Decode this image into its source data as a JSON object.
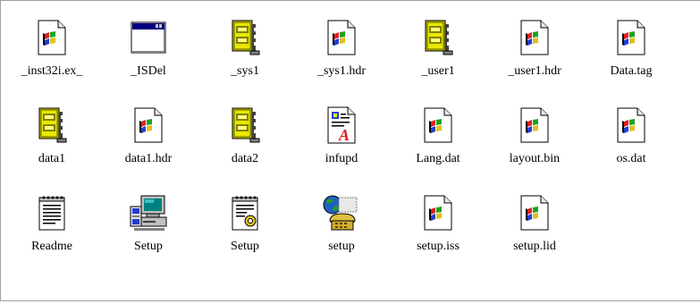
{
  "files": [
    {
      "label": "_inst32i.ex_",
      "icon": "generic-file-icon"
    },
    {
      "label": "_ISDel",
      "icon": "application-window-icon"
    },
    {
      "label": "_sys1",
      "icon": "compressed-archive-icon"
    },
    {
      "label": "_sys1.hdr",
      "icon": "generic-file-icon"
    },
    {
      "label": "_user1",
      "icon": "compressed-archive-icon"
    },
    {
      "label": "_user1.hdr",
      "icon": "generic-file-icon"
    },
    {
      "label": "Data.tag",
      "icon": "generic-file-icon"
    },
    {
      "label": "data1",
      "icon": "compressed-archive-icon"
    },
    {
      "label": "data1.hdr",
      "icon": "generic-file-icon"
    },
    {
      "label": "data2",
      "icon": "compressed-archive-icon"
    },
    {
      "label": "infupd",
      "icon": "wordpad-document-icon"
    },
    {
      "label": "Lang.dat",
      "icon": "generic-file-icon"
    },
    {
      "label": "layout.bin",
      "icon": "generic-file-icon"
    },
    {
      "label": "os.dat",
      "icon": "generic-file-icon"
    },
    {
      "label": "Readme",
      "icon": "notepad-text-icon"
    },
    {
      "label": "Setup",
      "icon": "setup-computer-icon"
    },
    {
      "label": "Setup",
      "icon": "setup-config-icon"
    },
    {
      "label": "setup",
      "icon": "internet-dialer-icon"
    },
    {
      "label": "setup.iss",
      "icon": "generic-file-icon"
    },
    {
      "label": "setup.lid",
      "icon": "generic-file-icon"
    }
  ],
  "colors": {
    "background": "#ffffff",
    "text": "#000000",
    "frame": "#a0a0a0"
  }
}
